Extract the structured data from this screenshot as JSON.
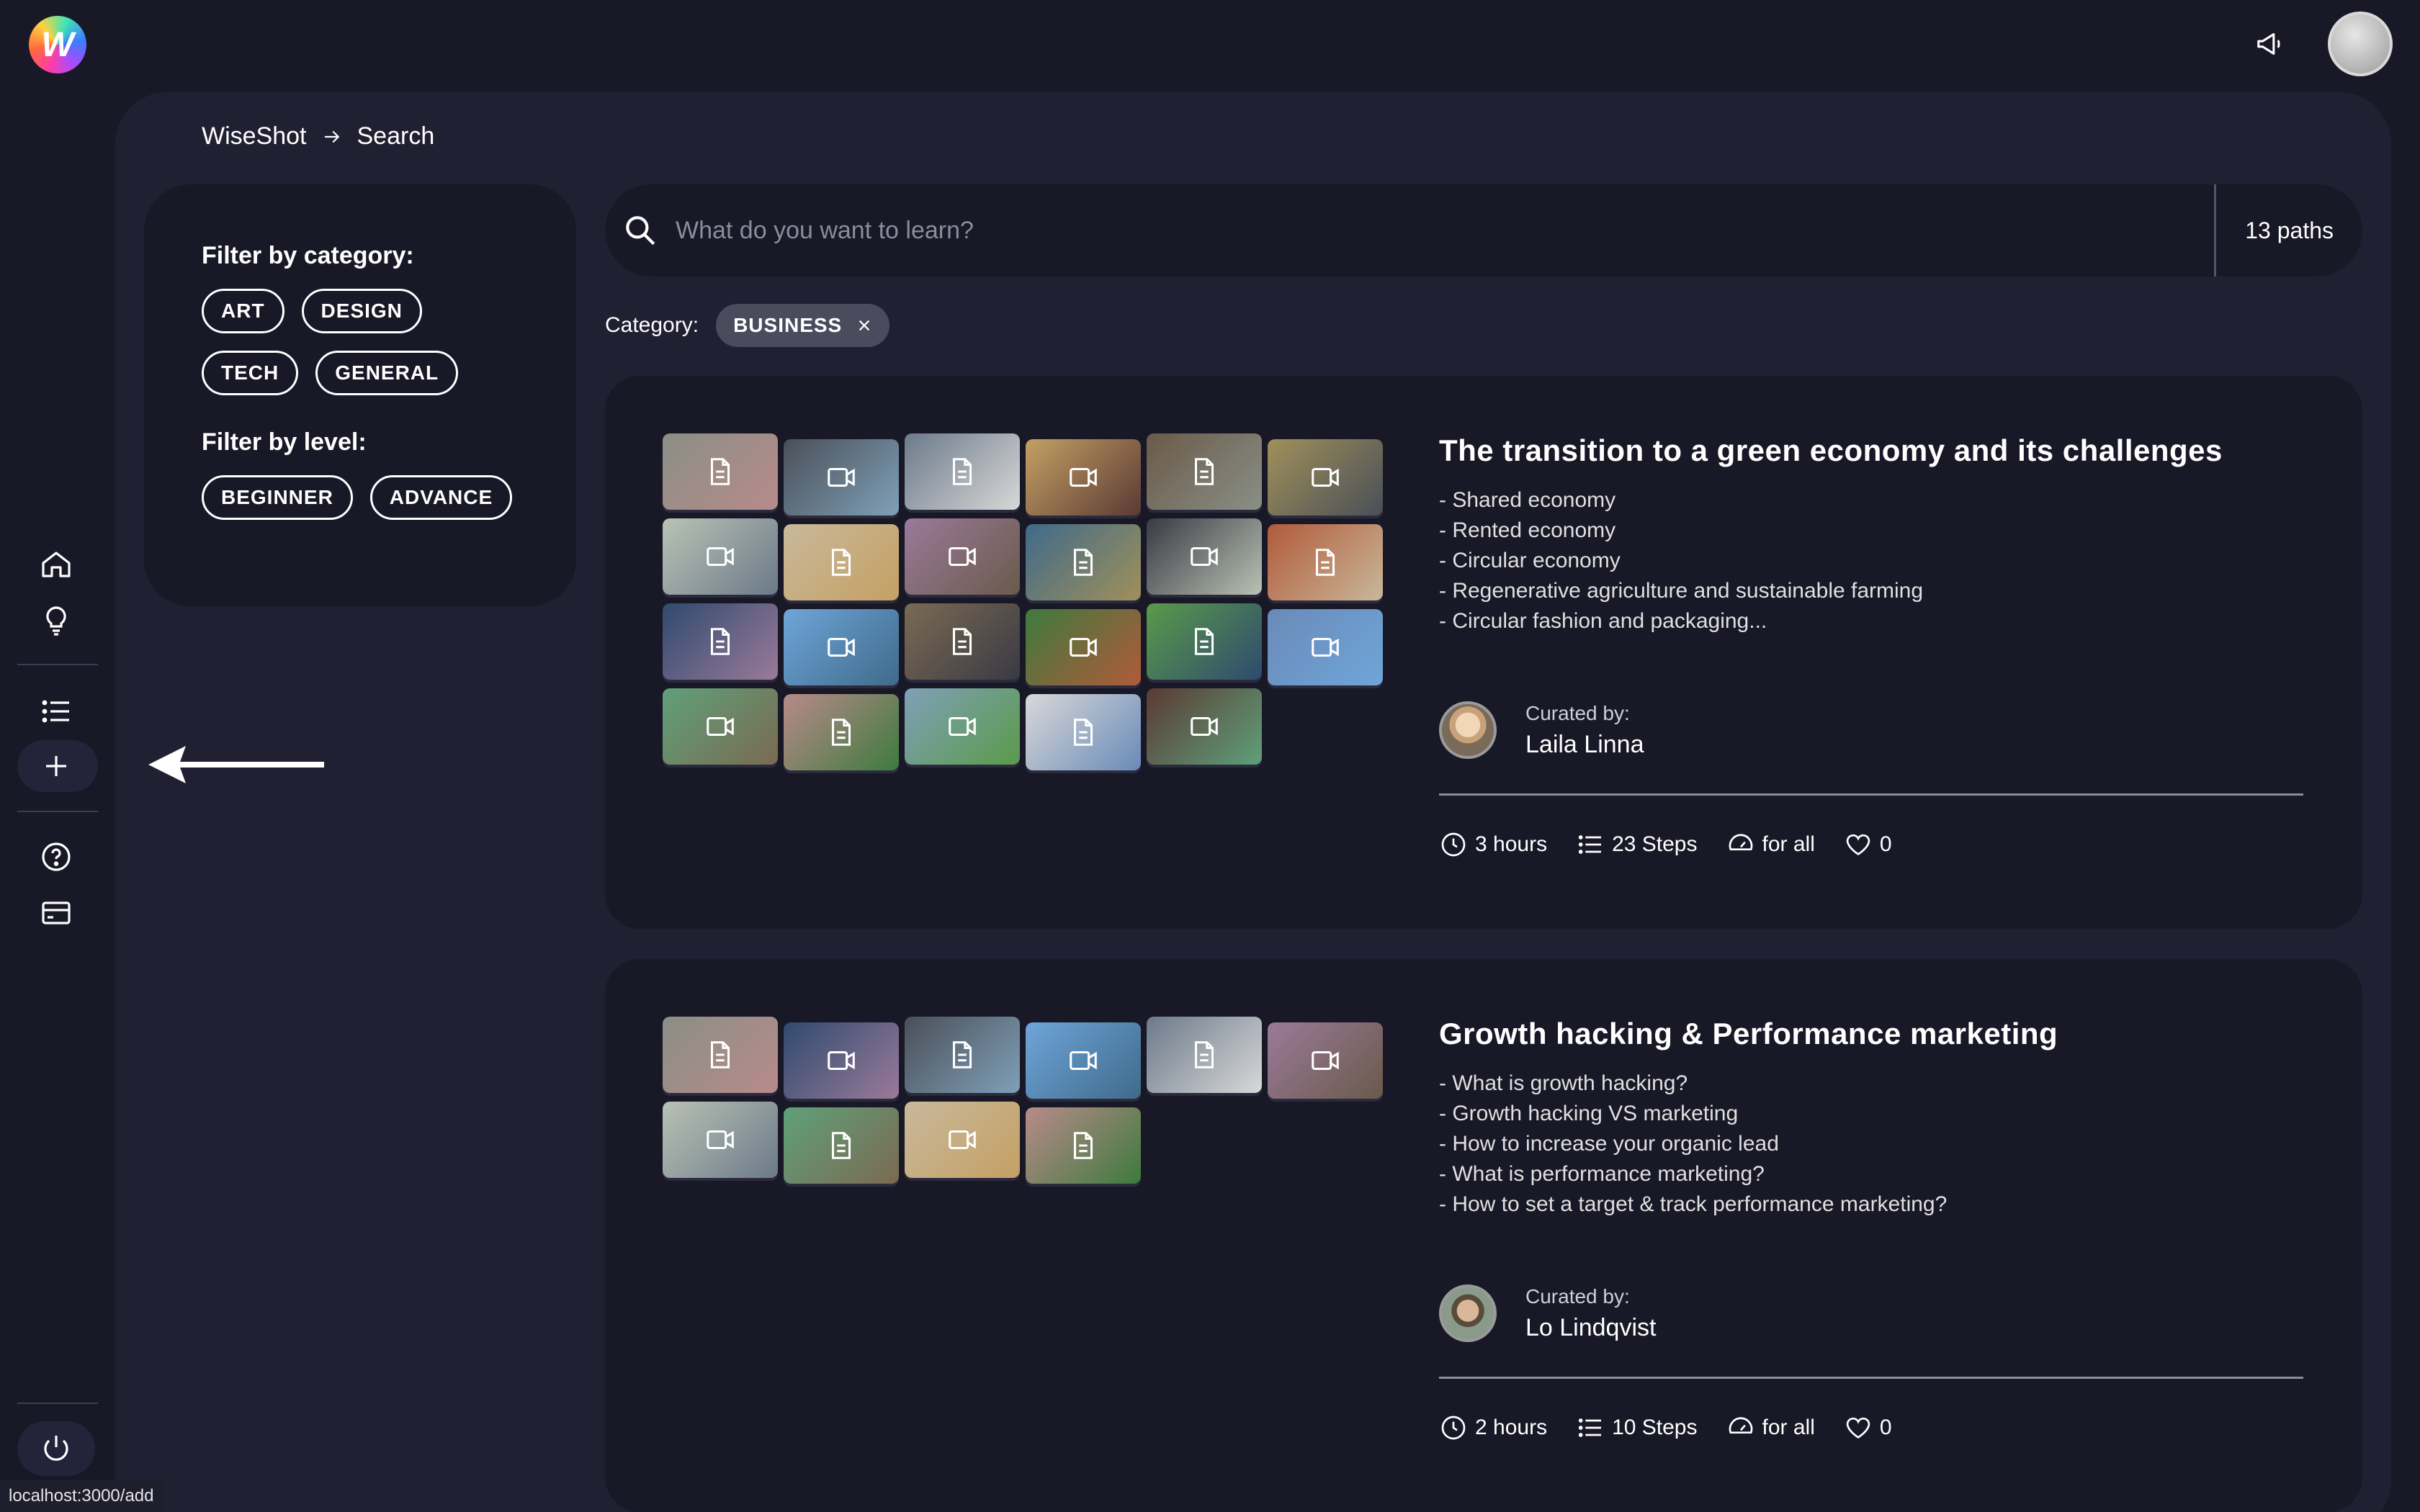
{
  "app": {
    "logo_letter": "W"
  },
  "breadcrumb": {
    "root": "WiseShot",
    "current": "Search"
  },
  "filters": {
    "category_title": "Filter by category:",
    "categories": [
      "ART",
      "DESIGN",
      "TECH",
      "GENERAL"
    ],
    "level_title": "Filter by level:",
    "levels": [
      "BEGINNER",
      "ADVANCE"
    ]
  },
  "search": {
    "placeholder": "What do you want to learn?",
    "count": "13 paths"
  },
  "active_category": {
    "label": "Category:",
    "value": "BUSINESS"
  },
  "paths": [
    {
      "title": "The transition to a green economy and its challenges",
      "bullets": [
        "- Shared economy",
        "- Rented economy",
        "- Circular economy",
        "- Regenerative agriculture and sustainable farming",
        "- Circular fashion and packaging..."
      ],
      "curated_label": "Curated by:",
      "curator": "Laila Linna",
      "duration": "3 hours",
      "steps": "23 Steps",
      "level": "for all",
      "likes": "0"
    },
    {
      "title": "Growth hacking & Performance marketing",
      "bullets": [
        "- What is growth hacking?",
        "- Growth hacking VS marketing",
        "- How to increase your organic lead",
        "- What is performance marketing?",
        "- How to set a target & track performance marketing?"
      ],
      "curated_label": "Curated by:",
      "curator": "Lo Lindqvist",
      "duration": "2 hours",
      "steps": "10 Steps",
      "level": "for all",
      "likes": "0"
    }
  ],
  "statusbar": {
    "url": "localhost:3000/add"
  },
  "colors": {
    "background": "#181827",
    "panel": "#202032",
    "chip_active": "#4b4b5e"
  }
}
